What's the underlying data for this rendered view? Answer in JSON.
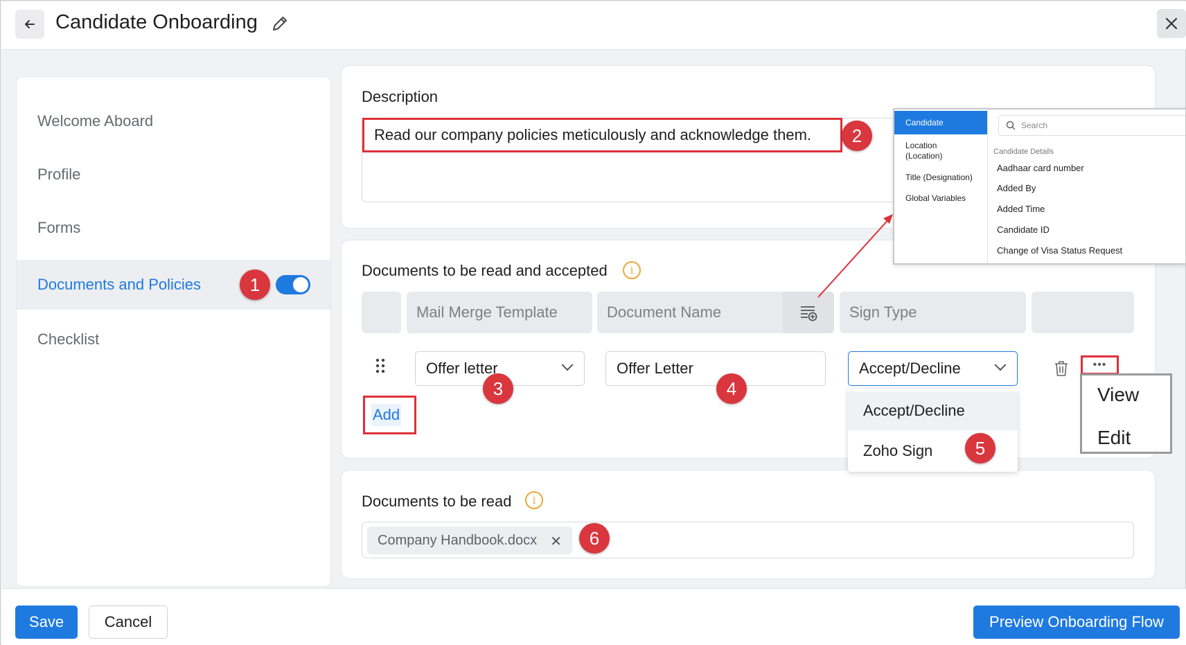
{
  "header": {
    "title": "Candidate Onboarding"
  },
  "sidebar": {
    "items": [
      {
        "label": "Welcome Aboard"
      },
      {
        "label": "Profile"
      },
      {
        "label": "Forms"
      },
      {
        "label": "Documents and Policies",
        "active": true,
        "toggle_on": true
      },
      {
        "label": "Checklist"
      }
    ]
  },
  "description": {
    "title": "Description",
    "text": "Read our company policies meticulously and acknowledge them."
  },
  "documents_accept": {
    "title": "Documents to be read and accepted",
    "columns": [
      "Mail Merge Template",
      "Document Name",
      "Sign Type"
    ],
    "row": {
      "template": "Offer letter",
      "document_name": "Offer Letter",
      "sign_type": "Accept/Decline"
    },
    "sign_type_options": [
      "Accept/Decline",
      "Zoho Sign"
    ],
    "more_menu": [
      "View",
      "Edit"
    ],
    "add_label": "Add"
  },
  "documents_read": {
    "title": "Documents to be read",
    "files": [
      "Company Handbook.docx"
    ]
  },
  "merge_popup": {
    "categories": [
      "Candidate",
      "Location (Location)",
      "Title (Designation)",
      "Global Variables"
    ],
    "search_placeholder": "Search",
    "group_label": "Candidate Details",
    "fields": [
      "Aadhaar card number",
      "Added By",
      "Added Time",
      "Candidate ID",
      "Change of Visa Status Request"
    ]
  },
  "footer": {
    "save": "Save",
    "cancel": "Cancel",
    "preview": "Preview Onboarding Flow"
  },
  "callouts": [
    "1",
    "2",
    "3",
    "4",
    "5",
    "6"
  ],
  "colors": {
    "accent": "#1f7ae0",
    "callout": "#d9363e",
    "highlight": "#e0303a",
    "info": "#e9a83a"
  }
}
